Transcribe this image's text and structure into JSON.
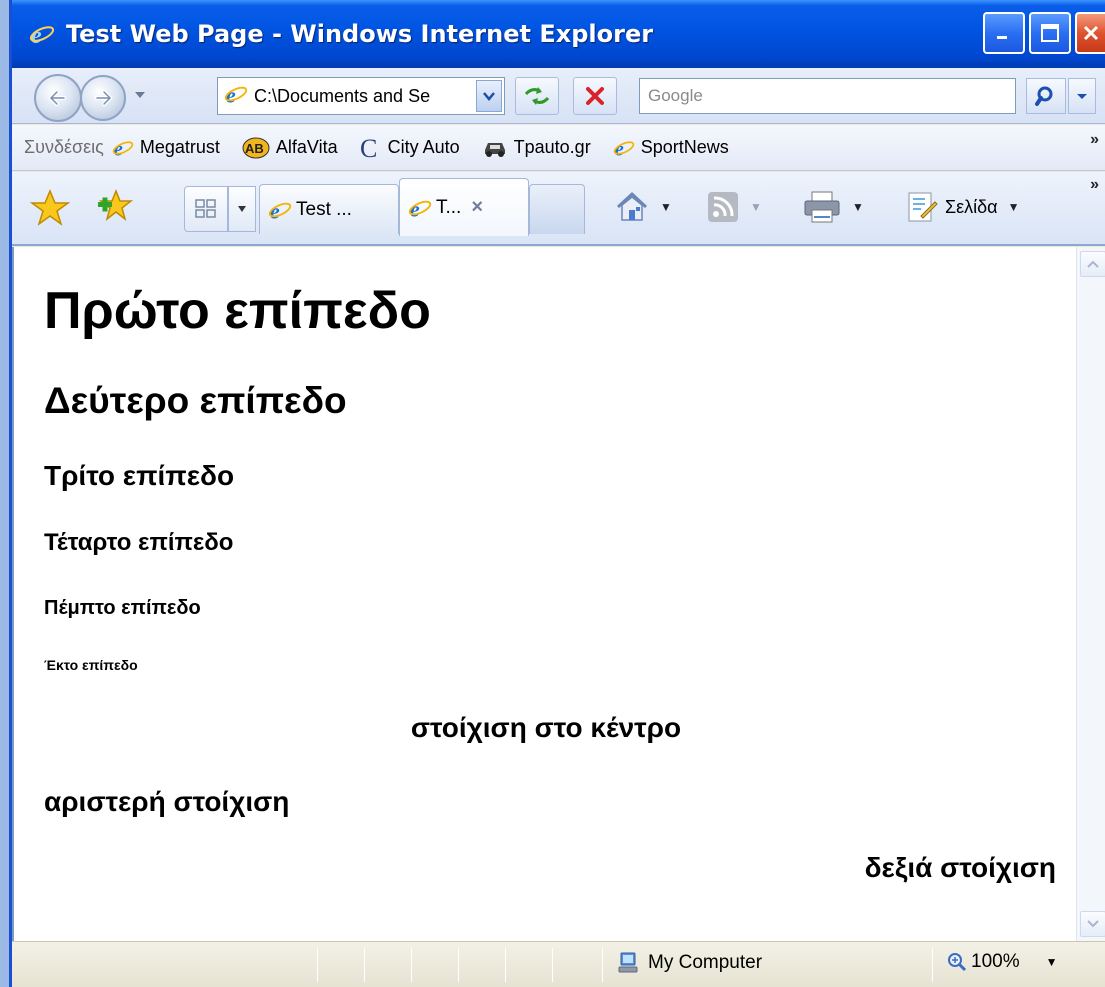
{
  "window": {
    "title": "Test Web Page - Windows Internet Explorer"
  },
  "address_bar": {
    "url": "C:\\Documents and Se",
    "search_placeholder": "Google"
  },
  "links_bar": {
    "label": "Συνδέσεις",
    "items": [
      "Megatrust",
      "AlfaVita",
      "City Auto",
      "Tpauto.gr",
      "SportNews"
    ],
    "more": "»"
  },
  "tabs": [
    {
      "label": "Test ..."
    },
    {
      "label": "T...",
      "close": "×"
    }
  ],
  "command_bar": {
    "page_label": "Σελίδα",
    "more": "»"
  },
  "content": {
    "h1": "Πρώτο επίπεδο",
    "h2": "Δεύτερο επίπεδο",
    "h3": "Τρίτο επίπεδο",
    "h4": "Τέταρτο επίπεδο",
    "h5": "Πέμπτο επίπεδο",
    "h6": "Έκτο επίπεδο",
    "center": "στοίχιση στο κέντρο",
    "left": "αριστερή στοίχιση",
    "right": "δεξιά στοίχιση"
  },
  "status_bar": {
    "zone": "My Computer",
    "zoom": "100%"
  },
  "icons": {
    "ie": "ie-logo-icon",
    "back": "back-arrow-icon",
    "forward": "forward-arrow-icon",
    "refresh": "refresh-icon",
    "stop": "stop-icon",
    "search": "search-icon",
    "favorites": "favorites-star-icon",
    "add_favorite": "add-favorite-icon",
    "home": "home-icon",
    "feeds": "rss-feed-icon",
    "print": "printer-icon",
    "page": "page-icon",
    "computer": "my-computer-icon",
    "zoom": "zoom-icon"
  },
  "colors": {
    "titlebar": "#0055e3",
    "close_button": "#e0532f",
    "chrome": "#ece9d8"
  }
}
